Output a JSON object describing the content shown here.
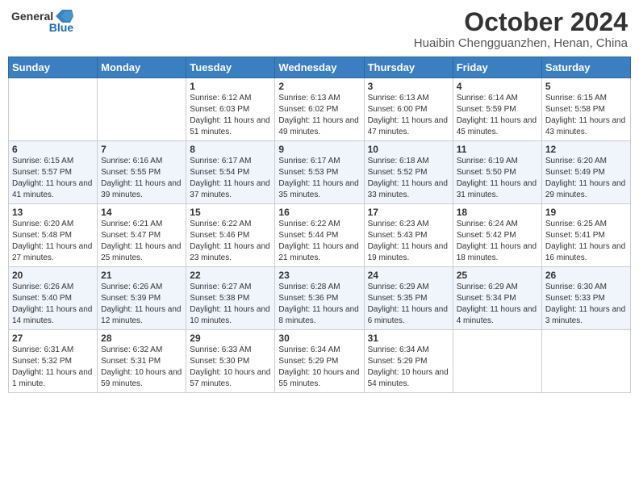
{
  "logo": {
    "text_general": "General",
    "text_blue": "Blue"
  },
  "title": {
    "month": "October 2024",
    "location": "Huaibin Chengguanzhen, Henan, China"
  },
  "weekdays": [
    "Sunday",
    "Monday",
    "Tuesday",
    "Wednesday",
    "Thursday",
    "Friday",
    "Saturday"
  ],
  "weeks": [
    [
      {
        "day": "",
        "info": ""
      },
      {
        "day": "",
        "info": ""
      },
      {
        "day": "1",
        "info": "Sunrise: 6:12 AM\nSunset: 6:03 PM\nDaylight: 11 hours and 51 minutes."
      },
      {
        "day": "2",
        "info": "Sunrise: 6:13 AM\nSunset: 6:02 PM\nDaylight: 11 hours and 49 minutes."
      },
      {
        "day": "3",
        "info": "Sunrise: 6:13 AM\nSunset: 6:00 PM\nDaylight: 11 hours and 47 minutes."
      },
      {
        "day": "4",
        "info": "Sunrise: 6:14 AM\nSunset: 5:59 PM\nDaylight: 11 hours and 45 minutes."
      },
      {
        "day": "5",
        "info": "Sunrise: 6:15 AM\nSunset: 5:58 PM\nDaylight: 11 hours and 43 minutes."
      }
    ],
    [
      {
        "day": "6",
        "info": "Sunrise: 6:15 AM\nSunset: 5:57 PM\nDaylight: 11 hours and 41 minutes."
      },
      {
        "day": "7",
        "info": "Sunrise: 6:16 AM\nSunset: 5:55 PM\nDaylight: 11 hours and 39 minutes."
      },
      {
        "day": "8",
        "info": "Sunrise: 6:17 AM\nSunset: 5:54 PM\nDaylight: 11 hours and 37 minutes."
      },
      {
        "day": "9",
        "info": "Sunrise: 6:17 AM\nSunset: 5:53 PM\nDaylight: 11 hours and 35 minutes."
      },
      {
        "day": "10",
        "info": "Sunrise: 6:18 AM\nSunset: 5:52 PM\nDaylight: 11 hours and 33 minutes."
      },
      {
        "day": "11",
        "info": "Sunrise: 6:19 AM\nSunset: 5:50 PM\nDaylight: 11 hours and 31 minutes."
      },
      {
        "day": "12",
        "info": "Sunrise: 6:20 AM\nSunset: 5:49 PM\nDaylight: 11 hours and 29 minutes."
      }
    ],
    [
      {
        "day": "13",
        "info": "Sunrise: 6:20 AM\nSunset: 5:48 PM\nDaylight: 11 hours and 27 minutes."
      },
      {
        "day": "14",
        "info": "Sunrise: 6:21 AM\nSunset: 5:47 PM\nDaylight: 11 hours and 25 minutes."
      },
      {
        "day": "15",
        "info": "Sunrise: 6:22 AM\nSunset: 5:46 PM\nDaylight: 11 hours and 23 minutes."
      },
      {
        "day": "16",
        "info": "Sunrise: 6:22 AM\nSunset: 5:44 PM\nDaylight: 11 hours and 21 minutes."
      },
      {
        "day": "17",
        "info": "Sunrise: 6:23 AM\nSunset: 5:43 PM\nDaylight: 11 hours and 19 minutes."
      },
      {
        "day": "18",
        "info": "Sunrise: 6:24 AM\nSunset: 5:42 PM\nDaylight: 11 hours and 18 minutes."
      },
      {
        "day": "19",
        "info": "Sunrise: 6:25 AM\nSunset: 5:41 PM\nDaylight: 11 hours and 16 minutes."
      }
    ],
    [
      {
        "day": "20",
        "info": "Sunrise: 6:26 AM\nSunset: 5:40 PM\nDaylight: 11 hours and 14 minutes."
      },
      {
        "day": "21",
        "info": "Sunrise: 6:26 AM\nSunset: 5:39 PM\nDaylight: 11 hours and 12 minutes."
      },
      {
        "day": "22",
        "info": "Sunrise: 6:27 AM\nSunset: 5:38 PM\nDaylight: 11 hours and 10 minutes."
      },
      {
        "day": "23",
        "info": "Sunrise: 6:28 AM\nSunset: 5:36 PM\nDaylight: 11 hours and 8 minutes."
      },
      {
        "day": "24",
        "info": "Sunrise: 6:29 AM\nSunset: 5:35 PM\nDaylight: 11 hours and 6 minutes."
      },
      {
        "day": "25",
        "info": "Sunrise: 6:29 AM\nSunset: 5:34 PM\nDaylight: 11 hours and 4 minutes."
      },
      {
        "day": "26",
        "info": "Sunrise: 6:30 AM\nSunset: 5:33 PM\nDaylight: 11 hours and 3 minutes."
      }
    ],
    [
      {
        "day": "27",
        "info": "Sunrise: 6:31 AM\nSunset: 5:32 PM\nDaylight: 11 hours and 1 minute."
      },
      {
        "day": "28",
        "info": "Sunrise: 6:32 AM\nSunset: 5:31 PM\nDaylight: 10 hours and 59 minutes."
      },
      {
        "day": "29",
        "info": "Sunrise: 6:33 AM\nSunset: 5:30 PM\nDaylight: 10 hours and 57 minutes."
      },
      {
        "day": "30",
        "info": "Sunrise: 6:34 AM\nSunset: 5:29 PM\nDaylight: 10 hours and 55 minutes."
      },
      {
        "day": "31",
        "info": "Sunrise: 6:34 AM\nSunset: 5:29 PM\nDaylight: 10 hours and 54 minutes."
      },
      {
        "day": "",
        "info": ""
      },
      {
        "day": "",
        "info": ""
      }
    ]
  ]
}
